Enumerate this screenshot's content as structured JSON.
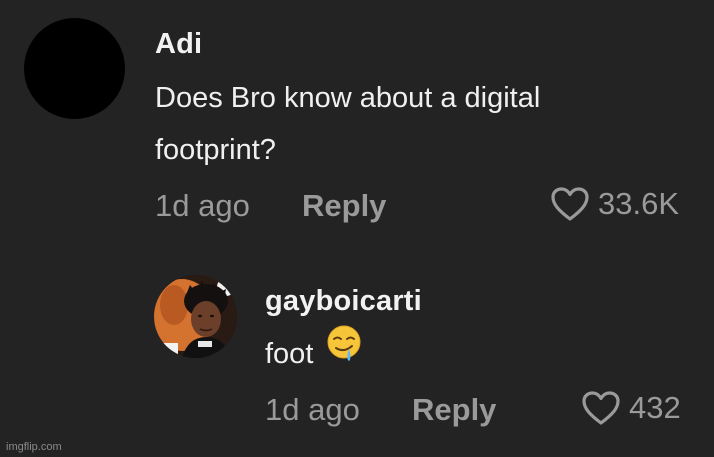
{
  "comment": {
    "username": "Adi",
    "text_line1": "Does Bro know about a digital",
    "text_line2": "footprint?",
    "time": "1d ago",
    "reply_label": "Reply",
    "likes": "33.6K"
  },
  "reply": {
    "username": "gayboicarti",
    "text": "foot",
    "emoji": "drooling-face",
    "time": "1d ago",
    "reply_label": "Reply",
    "likes": "432"
  },
  "watermark": "imgflip.com",
  "colors": {
    "background": "#232323",
    "primary_text": "#f0f0f0",
    "secondary_text": "#9a9a9a",
    "emoji_yellow": "#f7c53a",
    "avatar_main": "#000000",
    "avatar_reply_bg": "#d4722f"
  }
}
